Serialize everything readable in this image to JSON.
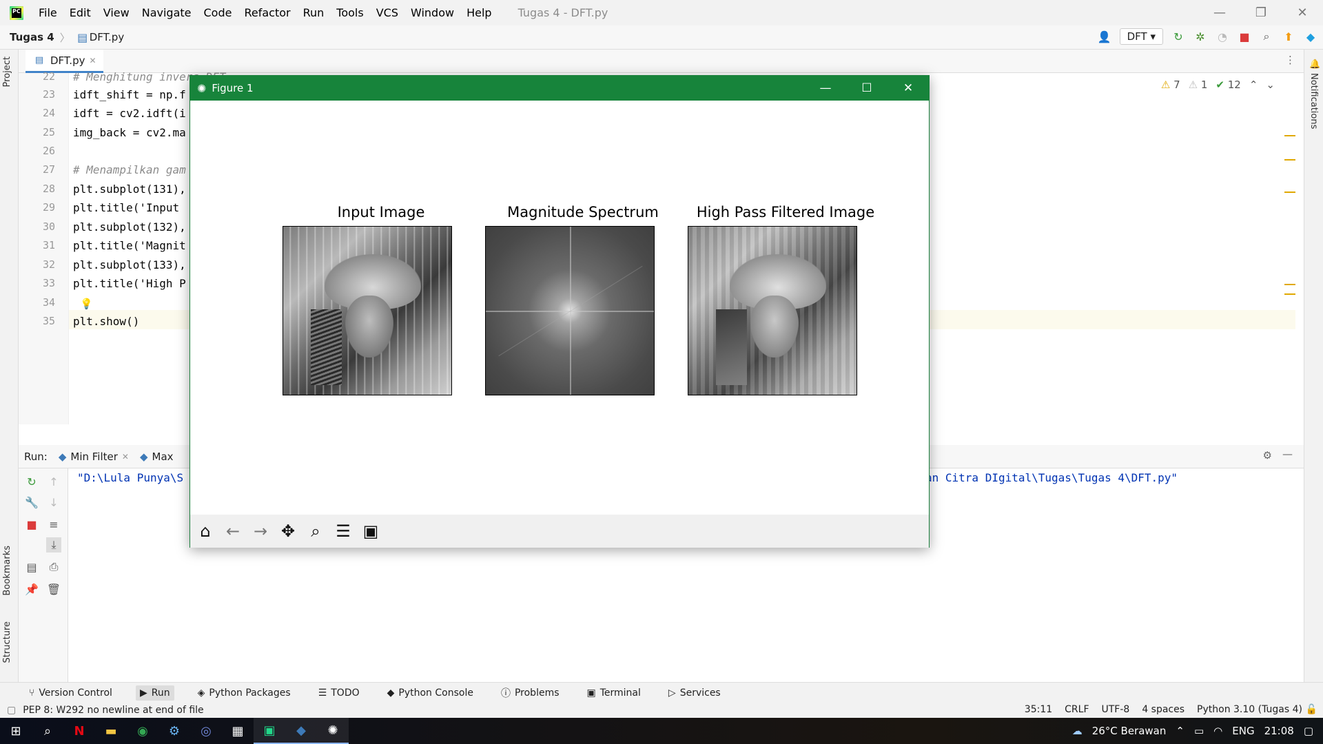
{
  "menubar": {
    "items": [
      "File",
      "Edit",
      "View",
      "Navigate",
      "Code",
      "Refactor",
      "Run",
      "Tools",
      "VCS",
      "Window",
      "Help"
    ],
    "window_title": "Tugas 4 - DFT.py"
  },
  "navbar": {
    "project": "Tugas 4",
    "file": "DFT.py",
    "run_config": "DFT"
  },
  "side_labels": {
    "project": "Project",
    "bookmarks": "Bookmarks",
    "structure": "Structure",
    "notifications": "Notifications"
  },
  "editor": {
    "tab": "DFT.py",
    "inspections": {
      "warnings": "7",
      "weak": "1",
      "ok": "12"
    },
    "lines": [
      {
        "n": "22",
        "text": "# Menghitung invers DFT"
      },
      {
        "n": "23",
        "text": "idft_shift = np.f"
      },
      {
        "n": "24",
        "text": "idft = cv2.idft(i"
      },
      {
        "n": "25",
        "text": "img_back = cv2.ma"
      },
      {
        "n": "26",
        "text": ""
      },
      {
        "n": "27",
        "text": "# Menampilkan gam"
      },
      {
        "n": "28",
        "text": "plt.subplot(131),"
      },
      {
        "n": "29",
        "text": "plt.title('Input "
      },
      {
        "n": "30",
        "text": "plt.subplot(132),"
      },
      {
        "n": "31",
        "text": "plt.title('Magnit"
      },
      {
        "n": "32",
        "text": "plt.subplot(133),"
      },
      {
        "n": "33",
        "text": "plt.title('High P"
      },
      {
        "n": "34",
        "text": ""
      },
      {
        "n": "35",
        "text": "plt.show()"
      }
    ]
  },
  "run": {
    "label": "Run:",
    "tabs": [
      "Min Filter",
      "Max"
    ],
    "output_left": "\"D:\\Lula Punya\\S",
    "output_right": "an Citra DIgital\\Tugas\\Tugas 4\\DFT.py\""
  },
  "figure": {
    "title": "Figure 1",
    "plots": [
      "Input Image",
      "Magnitude Spectrum",
      "High Pass Filtered Image"
    ]
  },
  "tool_windows": [
    "Version Control",
    "Run",
    "Python Packages",
    "TODO",
    "Python Console",
    "Problems",
    "Terminal",
    "Services"
  ],
  "statusbar": {
    "message": "PEP 8: W292 no newline at end of file",
    "position": "35:11",
    "line_sep": "CRLF",
    "encoding": "UTF-8",
    "indent": "4 spaces",
    "interpreter": "Python 3.10 (Tugas 4)"
  },
  "taskbar": {
    "weather": "26°C  Berawan",
    "lang": "ENG",
    "time": "21:08"
  }
}
